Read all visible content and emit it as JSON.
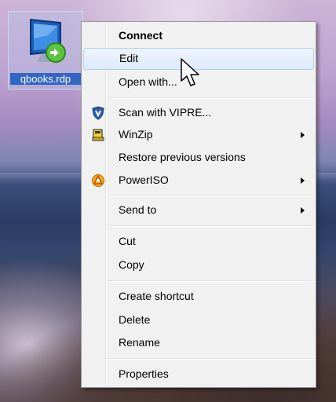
{
  "desktop": {
    "icon": {
      "name": "rdp-file-icon",
      "label": "qbooks.rdp"
    }
  },
  "context_menu": {
    "items": [
      {
        "label": "Connect",
        "bold": true
      },
      {
        "label": "Edit",
        "highlighted": true
      },
      {
        "label": "Open with..."
      },
      {
        "label": "Scan with VIPRE...",
        "icon": "vipre-shield-icon"
      },
      {
        "label": "WinZip",
        "icon": "winzip-icon",
        "submenu": true
      },
      {
        "label": "Restore previous versions"
      },
      {
        "label": "PowerISO",
        "icon": "poweriso-icon",
        "submenu": true
      },
      {
        "label": "Send to",
        "submenu": true
      },
      {
        "label": "Cut"
      },
      {
        "label": "Copy"
      },
      {
        "label": "Create shortcut"
      },
      {
        "label": "Delete"
      },
      {
        "label": "Rename"
      },
      {
        "label": "Properties"
      }
    ]
  },
  "colors": {
    "menu_background": "#f1f1f1",
    "highlight": "#dceafd",
    "highlight_border": "#aecff7",
    "label_background": "#3166c4"
  }
}
